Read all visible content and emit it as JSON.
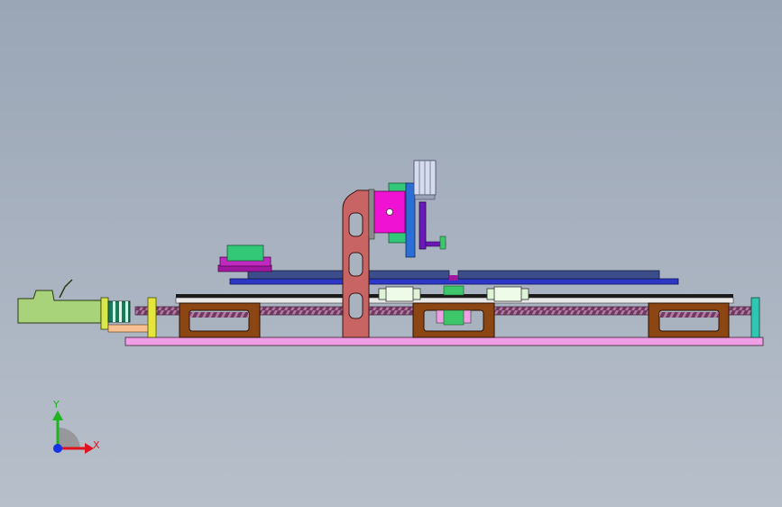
{
  "viewport": {
    "background": "#a3adbb"
  },
  "triad": {
    "x_label": "X",
    "y_label": "Y",
    "x_color": "#e0141e",
    "y_color": "#1eb41e",
    "z_color": "#1432e6"
  },
  "parts": {
    "base_plate_color": "#f09ee6",
    "bracket_color": "#8c4614",
    "screw_color": "#8e4f7e",
    "motor_color": "#a8d37a",
    "column_color": "#c86464",
    "slide_plate_color": "#2d38c8",
    "carrier_color": "#3b4d8a",
    "gripper_block_color": "#f012d2",
    "cylinder_color": "#d6dcf0",
    "bearing_block_color": "#dff3d6",
    "purple_pad_color": "#a018a0",
    "green_pad_color": "#32c878"
  }
}
